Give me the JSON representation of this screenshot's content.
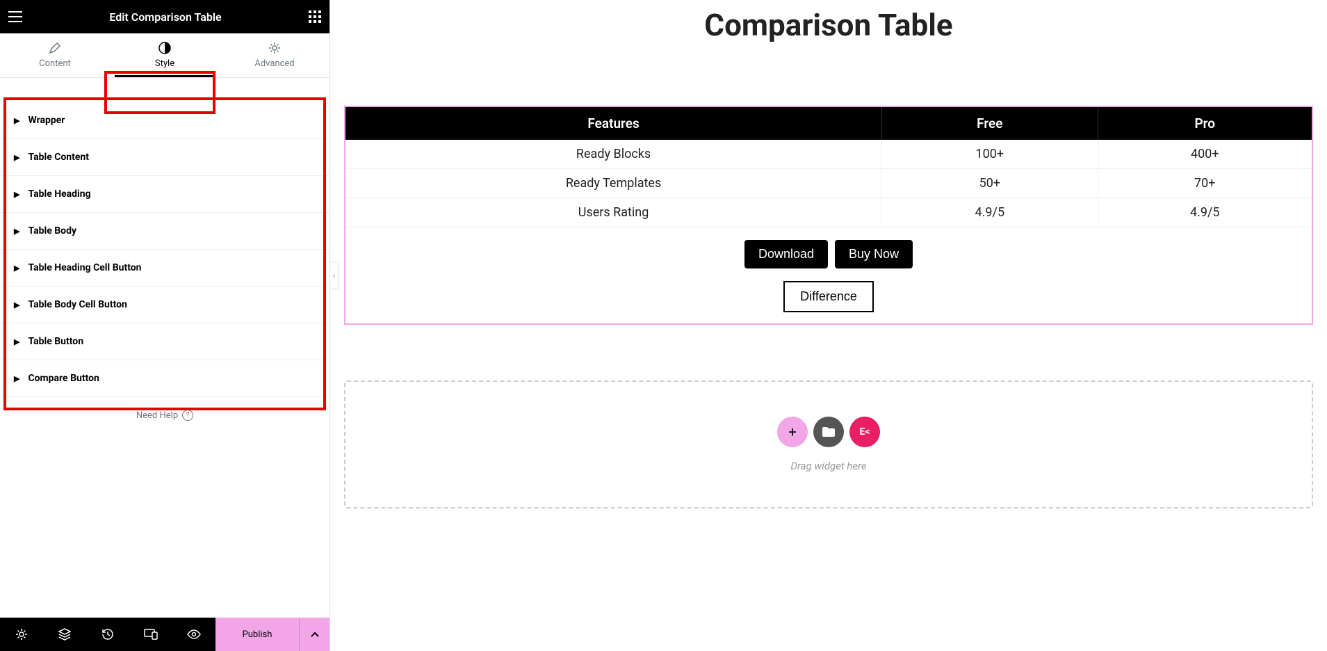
{
  "sidebar": {
    "title": "Edit Comparison Table",
    "tabs": [
      {
        "label": "Content",
        "icon": "pencil"
      },
      {
        "label": "Style",
        "icon": "contrast"
      },
      {
        "label": "Advanced",
        "icon": "gear"
      }
    ],
    "active_tab": 1,
    "sections": [
      "Wrapper",
      "Table Content",
      "Table Heading",
      "Table Body",
      "Table Heading Cell Button",
      "Table Body Cell Button",
      "Table Button",
      "Compare Button"
    ],
    "help_label": "Need Help",
    "publish_label": "Publish"
  },
  "canvas": {
    "page_title": "Comparison Table",
    "table": {
      "headers": [
        "Features",
        "Free",
        "Pro"
      ],
      "rows": [
        [
          "Ready Blocks",
          "100+",
          "400+"
        ],
        [
          "Ready Templates",
          "50+",
          "70+"
        ],
        [
          "Users Rating",
          "4.9/5",
          "4.9/5"
        ]
      ],
      "buttons": [
        "Download",
        "Buy Now"
      ],
      "diff_label": "Difference"
    },
    "dropzone_text": "Drag widget here"
  }
}
